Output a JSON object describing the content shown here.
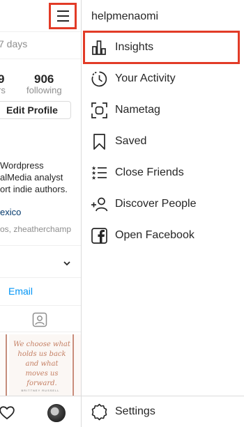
{
  "profile": {
    "days_text": "7 days",
    "stats": [
      {
        "value": "9",
        "label": "rs"
      },
      {
        "value": "906",
        "label": "following"
      }
    ],
    "edit_profile": "Edit Profile",
    "bio": [
      "Wordpress",
      "alMedia analyst",
      "ort indie authors."
    ],
    "location": "exico",
    "tagged": "os, zheatherchamp",
    "email": "Email",
    "post": {
      "quote": "We choose what holds us back and what moves us forward.",
      "author": "BRITTNEY RUSSELL"
    }
  },
  "drawer": {
    "username": "helpmenaomi",
    "items": [
      {
        "label": "Insights",
        "icon": "insights-icon"
      },
      {
        "label": "Your Activity",
        "icon": "activity-icon"
      },
      {
        "label": "Nametag",
        "icon": "nametag-icon"
      },
      {
        "label": "Saved",
        "icon": "bookmark-icon"
      },
      {
        "label": "Close Friends",
        "icon": "close-friends-icon"
      },
      {
        "label": "Discover People",
        "icon": "add-person-icon"
      },
      {
        "label": "Open Facebook",
        "icon": "facebook-icon"
      }
    ],
    "settings": {
      "label": "Settings",
      "icon": "settings-gear-icon"
    }
  },
  "colors": {
    "highlight": "#e23b27",
    "link": "#00376b",
    "email": "#0095f6",
    "text": "#262626",
    "muted": "#8e8e8e"
  }
}
